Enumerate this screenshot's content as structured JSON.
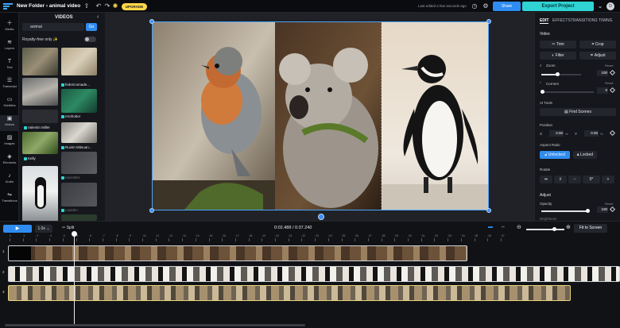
{
  "topbar": {
    "folder": "New Folder",
    "separator": "›",
    "project_name": "animal video",
    "upgrade_label": "UPGRADE",
    "saved_status": "Last edited a few seconds ago",
    "share_label": "Share",
    "export_label": "Export Project",
    "avatar_initial": "D"
  },
  "rail": {
    "items": [
      "Media",
      "Layers",
      "Text",
      "Transcript",
      "Subtitles",
      "Videos",
      "Images",
      "Elements",
      "Audio",
      "Transitions"
    ],
    "active": "Videos"
  },
  "media_panel": {
    "title": "VIDEOS",
    "search_value": "animal",
    "go_label": "Go",
    "royalty_free_label": "Royalty-free only ✨",
    "tiles": [
      {
        "label": ""
      },
      {
        "label": "federicomade..."
      },
      {
        "label": ""
      },
      {
        "label": "mrohober"
      },
      {
        "label": "Valentin Miller"
      },
      {
        "label": ""
      },
      {
        "label": "Kelly"
      },
      {
        "label": "Ruvim Mitsuan..."
      },
      {
        "label": ""
      },
      {
        "label": "nacestter"
      },
      {
        "label": ""
      },
      {
        "label": "Laviden"
      }
    ]
  },
  "inspector": {
    "tabs": [
      "EDIT",
      "EFFECTS",
      "TRANSITIONS",
      "TIMING"
    ],
    "active_tab": "EDIT",
    "video_section": "Video",
    "trim_label": "Trim",
    "crop_label": "Crop",
    "filter_label": "Filter",
    "adjust_label": "Adjust",
    "zoom_label": "Zoom",
    "zoom_value": "100",
    "zoom_level": 0.4,
    "corners_label": "Corners",
    "corners_value": "0",
    "reset_label": "Reset",
    "ai_tools_label": "AI Tools",
    "find_scenes_label": "Find Scenes",
    "position_label": "Position",
    "x_label": "X",
    "x_value": "0.00",
    "y_label": "Y",
    "y_value": "0.00",
    "unit": "%",
    "aspect_ratio_label": "Aspect Ratio",
    "unlocked_label": "Unlocked",
    "locked_label": "Locked",
    "rotate_label": "Rotate",
    "rotate_value": "0°",
    "adjust_section": "Adjust",
    "opacity_label": "Opacity",
    "opacity_value": "100",
    "opacity_level": 1.0,
    "brightness_label": "Brightness"
  },
  "timeline": {
    "speed": "1.0x",
    "split_label": "Split",
    "current_time": "0:02.488",
    "total_time": "0:37.240",
    "fit_label": "Fit to Screen",
    "ruler": [
      "0",
      ":1",
      ":2",
      ":3",
      ":4",
      ":5",
      ":6",
      ":7",
      ":8",
      ":9",
      ":10",
      ":11",
      ":12",
      ":13",
      ":14",
      ":15",
      ":16",
      ":17",
      ":18",
      ":19",
      ":20",
      ":21",
      ":22",
      ":23",
      ":24",
      ":25",
      ":26",
      ":27",
      ":28",
      ":29",
      ":30",
      ":31",
      ":32",
      ":33",
      ":34",
      ":35",
      ":36",
      ":37"
    ],
    "tracks": [
      "1",
      "2",
      "3"
    ]
  },
  "colors": {
    "accent": "#2f8cf0",
    "export": "#2fd3d3",
    "upgrade": "#ffd84a"
  }
}
